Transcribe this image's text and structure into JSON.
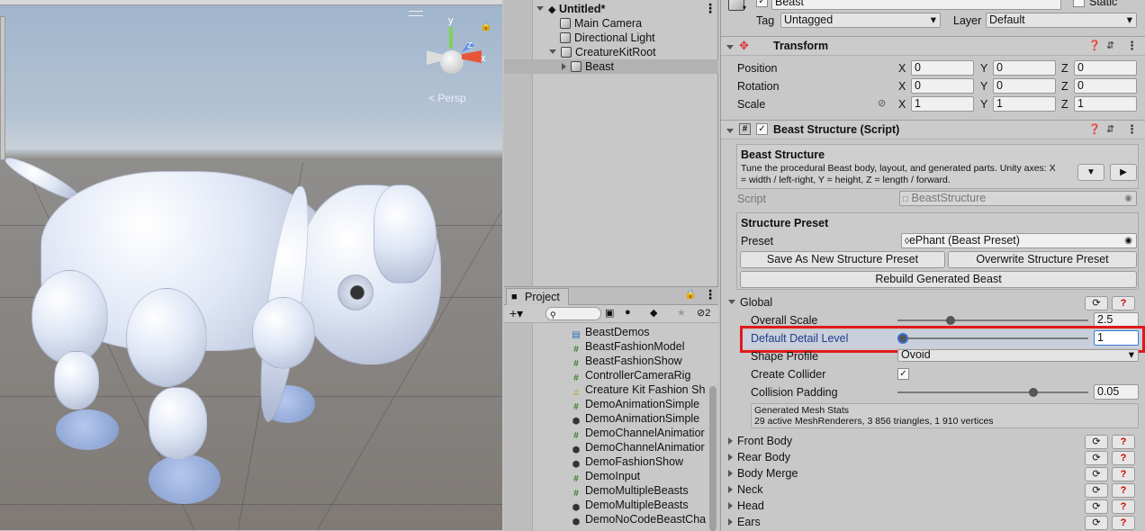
{
  "scene": {
    "persp_label": "Persp",
    "gizmo": {
      "x": "x",
      "y": "y",
      "z": "z"
    }
  },
  "hierarchy": {
    "scene_name": "Untitled*",
    "items": [
      {
        "label": "Main Camera"
      },
      {
        "label": "Directional Light"
      },
      {
        "label": "CreatureKitRoot"
      },
      {
        "label": "Beast"
      }
    ]
  },
  "project": {
    "tab_label": "Project",
    "hidden_count": "2",
    "assets": [
      {
        "label": "BeastDemos",
        "icon": "scene-file-icon"
      },
      {
        "label": "BeastFashionModel",
        "icon": "script-icon"
      },
      {
        "label": "BeastFashionShow",
        "icon": "script-icon"
      },
      {
        "label": "ControllerCameraRig",
        "icon": "script-icon"
      },
      {
        "label": "Creature Kit Fashion Sh",
        "icon": "audio-icon"
      },
      {
        "label": "DemoAnimationSimple",
        "icon": "script-icon"
      },
      {
        "label": "DemoAnimationSimple",
        "icon": "unity-scene-icon"
      },
      {
        "label": "DemoChannelAnimatior",
        "icon": "script-icon"
      },
      {
        "label": "DemoChannelAnimatior",
        "icon": "unity-scene-icon"
      },
      {
        "label": "DemoFashionShow",
        "icon": "unity-scene-icon"
      },
      {
        "label": "DemoInput",
        "icon": "script-icon"
      },
      {
        "label": "DemoMultipleBeasts",
        "icon": "script-icon"
      },
      {
        "label": "DemoMultipleBeasts",
        "icon": "unity-scene-icon"
      },
      {
        "label": "DemoNoCodeBeastCha",
        "icon": "unity-scene-icon"
      }
    ]
  },
  "inspector": {
    "object_name": "Beast",
    "static_label": "Static",
    "tag_label": "Tag",
    "tag_value": "Untagged",
    "layer_label": "Layer",
    "layer_value": "Default",
    "transform": {
      "title": "Transform",
      "rows": [
        {
          "label": "Position",
          "x": "0",
          "y": "0",
          "z": "0"
        },
        {
          "label": "Rotation",
          "x": "0",
          "y": "0",
          "z": "0"
        },
        {
          "label": "Scale",
          "x": "1",
          "y": "1",
          "z": "1"
        }
      ],
      "axis_x": "X",
      "axis_y": "Y",
      "axis_z": "Z"
    },
    "script_component": {
      "title": "Beast Structure (Script)",
      "help_title": "Beast Structure",
      "help_text_1": "Tune the procedural Beast body, layout, and generated parts. Unity axes: X",
      "help_text_2": "= width / left-right, Y = height, Z = length / forward.",
      "script_label": "Script",
      "script_value": "BeastStructure",
      "preset_section": "Structure Preset",
      "preset_label": "Preset",
      "preset_value": "ePhant (Beast Preset)",
      "save_preset_button": "Save As New Structure Preset",
      "overwrite_preset_button": "Overwrite Structure Preset",
      "rebuild_button": "Rebuild Generated Beast",
      "global_label": "Global",
      "overall_scale_label": "Overall Scale",
      "overall_scale_value": "2.5",
      "overall_scale_fraction": 0.26,
      "detail_label": "Default Detail Level",
      "detail_value": "1",
      "detail_fraction": 0.0,
      "shape_label": "Shape Profile",
      "shape_value": "Ovoid",
      "collider_label": "Create Collider",
      "padding_label": "Collision Padding",
      "padding_value": "0.05",
      "padding_fraction": 0.71,
      "stats_title": "Generated Mesh Stats",
      "stats_text": "29 active MeshRenderers, 3 856 triangles, 1 910 vertices",
      "sections": [
        {
          "label": "Front Body"
        },
        {
          "label": "Rear Body"
        },
        {
          "label": "Body Merge"
        },
        {
          "label": "Neck"
        },
        {
          "label": "Head"
        },
        {
          "label": "Ears"
        }
      ],
      "help_glyph": "?"
    },
    "highlight_color": "#e0191b"
  }
}
